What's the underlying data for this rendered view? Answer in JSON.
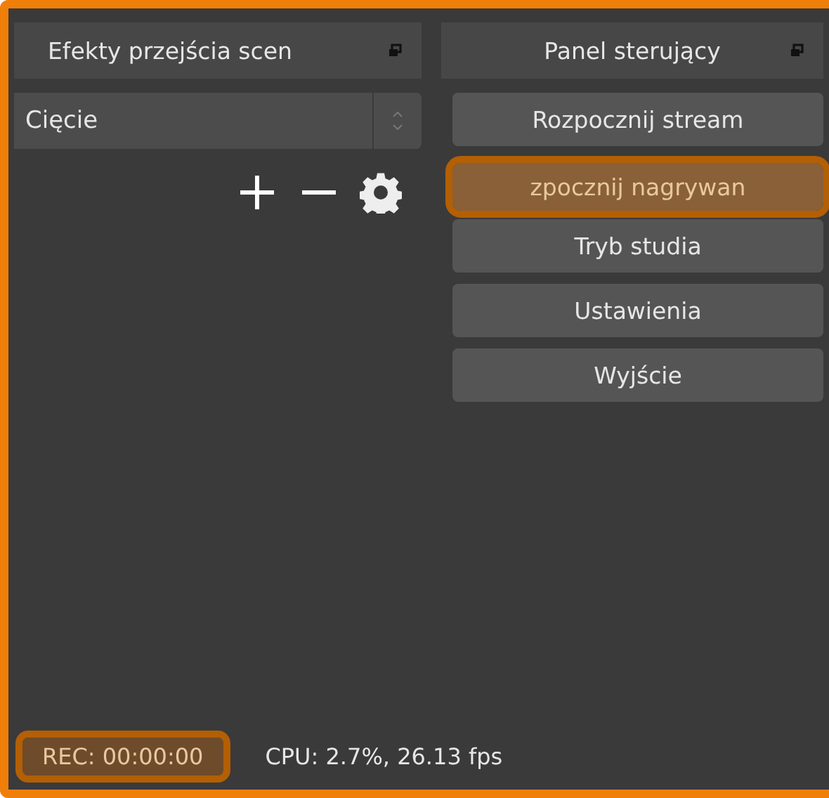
{
  "transitions_panel": {
    "title": "Efekty przejścia scen",
    "transition": "Cięcie"
  },
  "controls_panel": {
    "title": "Panel sterujący",
    "buttons": [
      {
        "label": "Rozpocznij stream",
        "highlighted": false
      },
      {
        "label": "zpocznij nagrywan",
        "highlighted": true
      },
      {
        "label": "Tryb studia",
        "highlighted": false
      },
      {
        "label": "Ustawienia",
        "highlighted": false
      },
      {
        "label": "Wyjście",
        "highlighted": false
      }
    ]
  },
  "status_bar": {
    "rec": {
      "text": "REC: 00:00:00",
      "highlighted": true
    },
    "cpu": "CPU: 2.7%, 26.13 fps"
  }
}
